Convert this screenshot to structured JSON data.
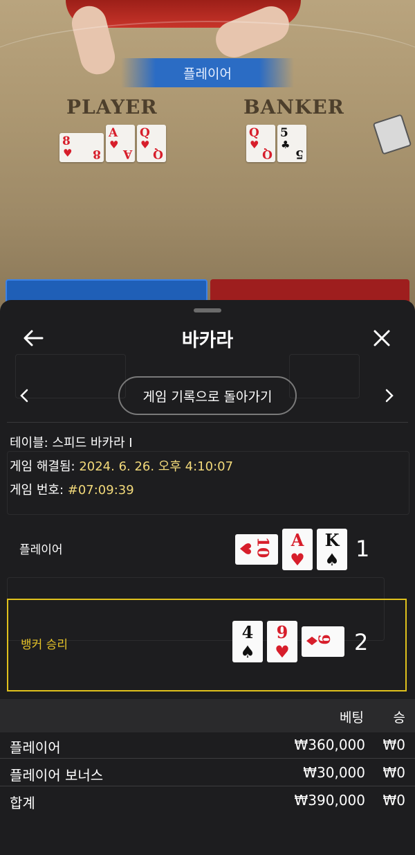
{
  "table_view": {
    "banner": "플레이어",
    "player_label": "PLAYER",
    "banker_label": "BANKER",
    "player_cards": [
      {
        "rank": "8",
        "suit": "♥",
        "color": "red",
        "sideways": true
      },
      {
        "rank": "A",
        "suit": "♥",
        "color": "red",
        "sideways": false
      },
      {
        "rank": "Q",
        "suit": "♥",
        "color": "red",
        "sideways": false
      }
    ],
    "banker_cards": [
      {
        "rank": "Q",
        "suit": "♥",
        "color": "red",
        "sideways": false
      },
      {
        "rank": "5",
        "suit": "♣",
        "color": "black",
        "sideways": false
      }
    ],
    "colors": {
      "player_blue": "#1f5fb7",
      "banker_red": "#9e1e1e",
      "banner_blue": "#2b6cc4"
    }
  },
  "sheet": {
    "title": "바카라",
    "back_icon": "arrow-left-icon",
    "close_icon": "close-icon",
    "back_to_history_label": "게임 기록으로 돌아가기",
    "prev_icon": "chevron-left-icon",
    "next_icon": "chevron-right-icon",
    "info": {
      "table_label": "테이블: ",
      "table_value": "스피드 바카라 I",
      "resolved_label": "게임 해결됨: ",
      "resolved_value": "2024. 6. 26. 오후 4:10:07",
      "game_no_label": "게임 번호: ",
      "game_no_value": "#07:09:39"
    },
    "hands": {
      "player": {
        "label": "플레이어",
        "score": "1",
        "cards": [
          {
            "rank": "10",
            "suit": "♥",
            "color": "red",
            "sideways": true
          },
          {
            "rank": "A",
            "suit": "♥",
            "color": "red",
            "sideways": false
          },
          {
            "rank": "K",
            "suit": "♠",
            "color": "black",
            "sideways": false
          }
        ]
      },
      "banker": {
        "label": "뱅커 승리",
        "score": "2",
        "cards": [
          {
            "rank": "4",
            "suit": "♠",
            "color": "black",
            "sideways": false
          },
          {
            "rank": "9",
            "suit": "♥",
            "color": "red",
            "sideways": false
          },
          {
            "rank": "9",
            "suit": "♦",
            "color": "red",
            "sideways": true
          }
        ]
      }
    },
    "bets": {
      "header_bet": "베팅",
      "header_win": "승",
      "rows": [
        {
          "name": "플레이어",
          "amount": "₩360,000",
          "win": "₩0"
        },
        {
          "name": "플레이어 보너스",
          "amount": "₩30,000",
          "win": "₩0"
        },
        {
          "name": "합계",
          "amount": "₩390,000",
          "win": "₩0"
        }
      ]
    },
    "accent_gold": "#e0c21c"
  }
}
